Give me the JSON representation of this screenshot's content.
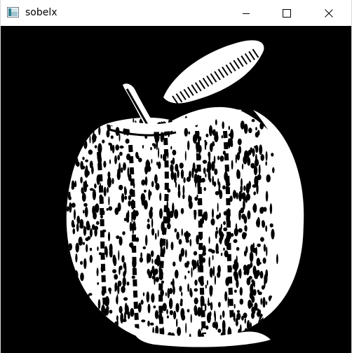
{
  "window": {
    "title": "sobelx",
    "app_icon": "image-window-icon",
    "controls": {
      "minimize_icon": "minimize-icon",
      "maximize_icon": "maximize-icon",
      "close_icon": "close-icon"
    }
  },
  "image": {
    "subject": "apple-sobel-edge-image",
    "background_color": "#000000",
    "foreground_color": "#ffffff"
  }
}
